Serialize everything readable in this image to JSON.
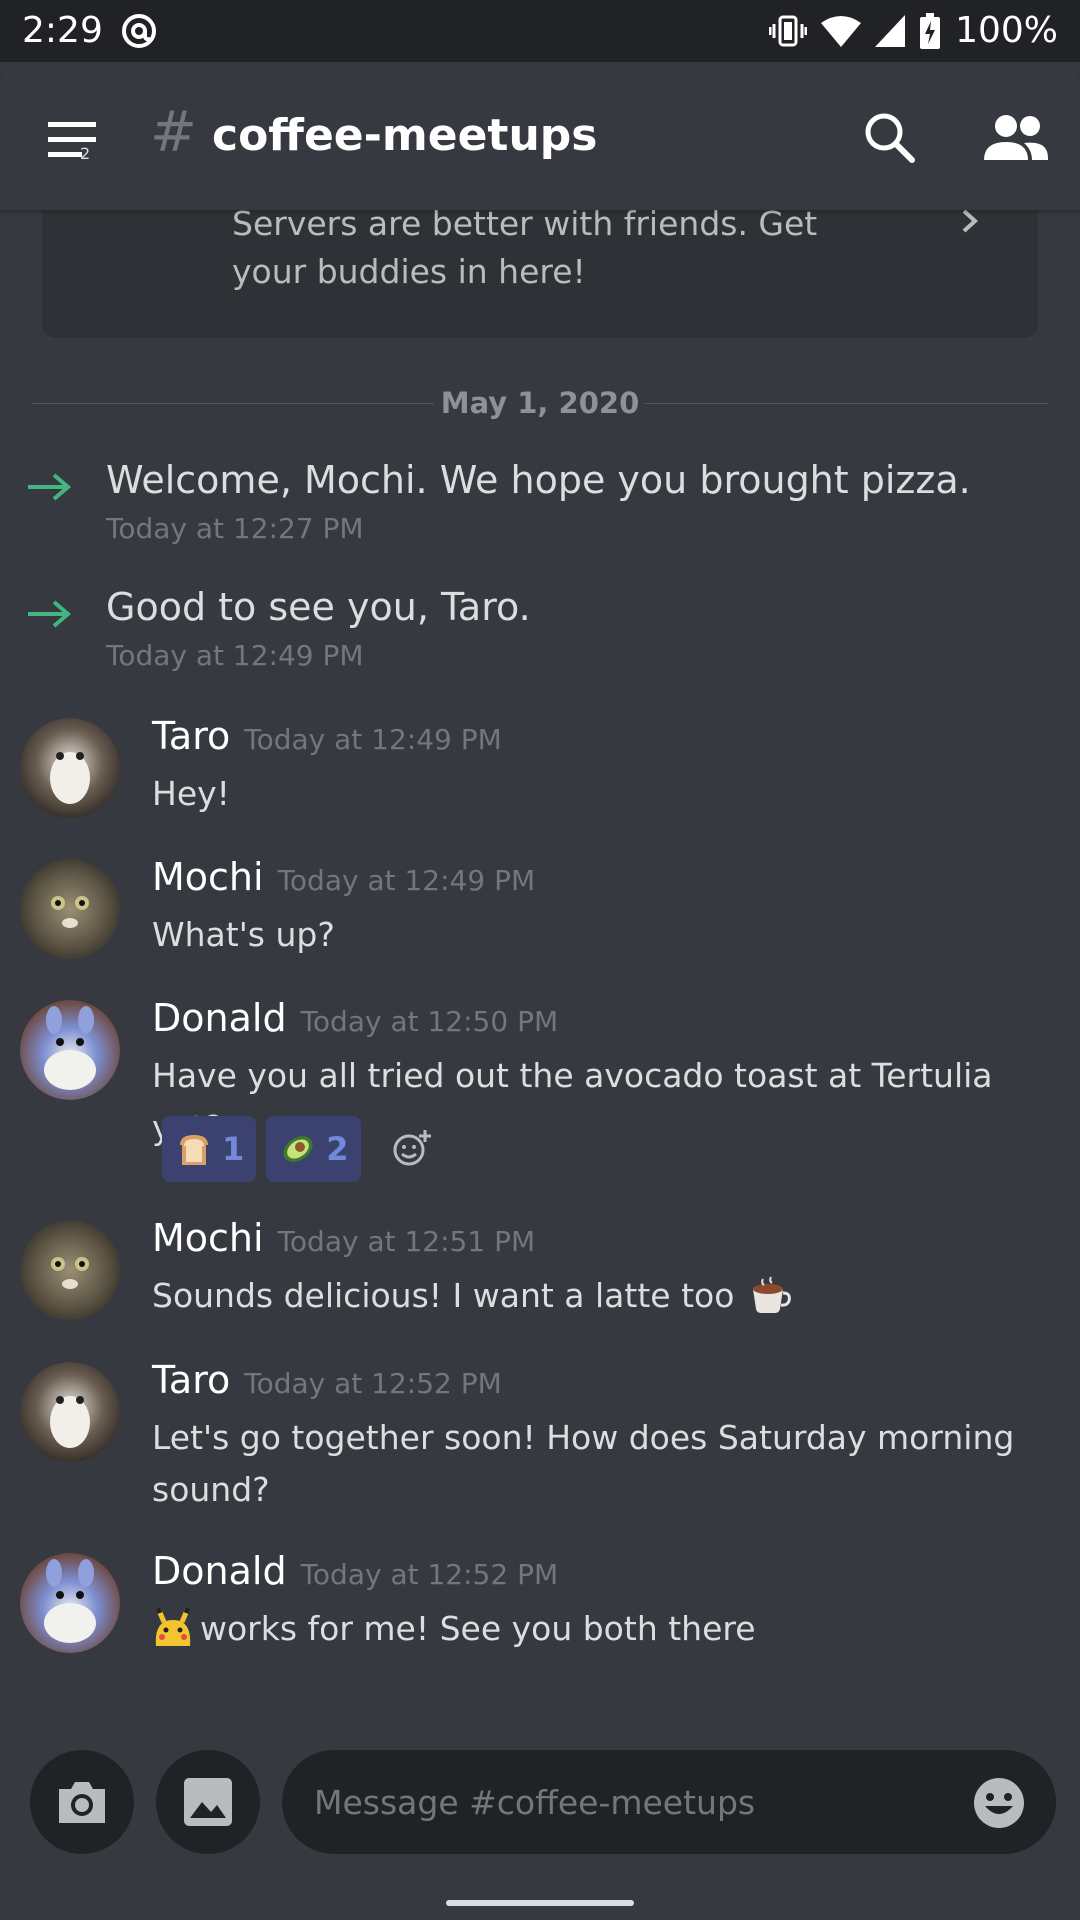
{
  "status_bar": {
    "time": "2:29",
    "battery": "100%",
    "icons": [
      "at-icon",
      "vibrate-icon",
      "wifi-icon",
      "signal-icon",
      "battery-charging-icon"
    ]
  },
  "header": {
    "menu_badge": "2",
    "hash": "#",
    "channel_name": "coffee-meetups",
    "icons": [
      "menu-icon",
      "search-icon",
      "members-icon"
    ]
  },
  "invite_card": {
    "text": "Servers are better with friends. Get your buddies in here!"
  },
  "divider": {
    "date": "May 1, 2020"
  },
  "system_messages": [
    {
      "text": "Welcome, Mochi. We hope you brought pizza.",
      "time": "Today at 12:27 PM"
    },
    {
      "text": "Good to see you, Taro.",
      "time": "Today at 12:49 PM"
    }
  ],
  "messages": [
    {
      "author": "Taro",
      "time": "Today at 12:49 PM",
      "text": "Hey!"
    },
    {
      "author": "Mochi",
      "time": "Today at 12:49 PM",
      "text": "What's up?"
    },
    {
      "author": "Donald",
      "time": "Today at 12:50 PM",
      "text": "Have you all tried out the avocado toast at Tertulia yet?"
    },
    {
      "author": "Mochi",
      "time": "Today at 12:51 PM",
      "text": "Sounds delicious! I want a latte too"
    },
    {
      "author": "Taro",
      "time": "Today at 12:52 PM",
      "text": "Let's go together soon! How does Saturday morning sound?"
    },
    {
      "author": "Donald",
      "time": "Today at 12:52 PM",
      "text": "works for me! See you both there"
    }
  ],
  "reactions": [
    {
      "emoji": "bread-emoji",
      "count": "1"
    },
    {
      "emoji": "avocado-emoji",
      "count": "2"
    }
  ],
  "composer": {
    "placeholder": "Message #coffee-meetups",
    "icons": [
      "camera-icon",
      "image-icon",
      "emoji-icon"
    ]
  },
  "colors": {
    "background": "#36393f",
    "status_bar": "#202225",
    "accent": "#7289da",
    "join_arrow": "#43b581",
    "badge": "#ed4245"
  }
}
